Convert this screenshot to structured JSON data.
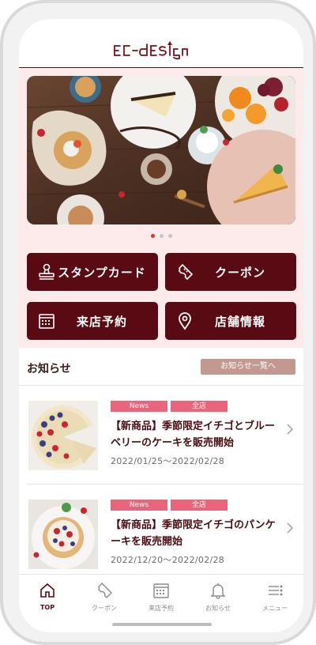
{
  "brand": {
    "logo_text": "EC-design"
  },
  "carousel": {
    "total": 3,
    "active": 0
  },
  "quick_buttons": [
    {
      "label": "スタンプカード",
      "icon": "stamp-icon"
    },
    {
      "label": "クーポン",
      "icon": "coupon-ticket-icon"
    },
    {
      "label": "来店予約",
      "icon": "calendar-icon"
    },
    {
      "label": "店舗情報",
      "icon": "map-pin-icon"
    }
  ],
  "news": {
    "heading": "お知らせ",
    "more_label": "お知らせ一覧へ",
    "items": [
      {
        "tags": [
          "News",
          "全店"
        ],
        "title": "【新商品】季節限定イチゴとブルーベリーのケーキを販売開始",
        "date": "2022/01/25〜2022/02/28"
      },
      {
        "tags": [
          "News",
          "全店"
        ],
        "title": "【新商品】季節限定イチゴのパンケーキを販売開始",
        "date": "2022/12/20〜2022/02/28"
      }
    ]
  },
  "tabbar": [
    {
      "label": "TOP",
      "icon": "home-icon",
      "active": true
    },
    {
      "label": "クーポン",
      "icon": "coupon-icon",
      "active": false
    },
    {
      "label": "来店予約",
      "icon": "calendar-icon",
      "active": false
    },
    {
      "label": "お知らせ",
      "icon": "bell-icon",
      "active": false
    },
    {
      "label": "メニュー",
      "icon": "menu-icon",
      "active": false
    }
  ],
  "colors": {
    "brand": "#5a0a12",
    "hero_bg": "#fdeaea",
    "tag": "#e9657b",
    "more_button": "#c2988f",
    "dot_active": "#e0302f"
  }
}
